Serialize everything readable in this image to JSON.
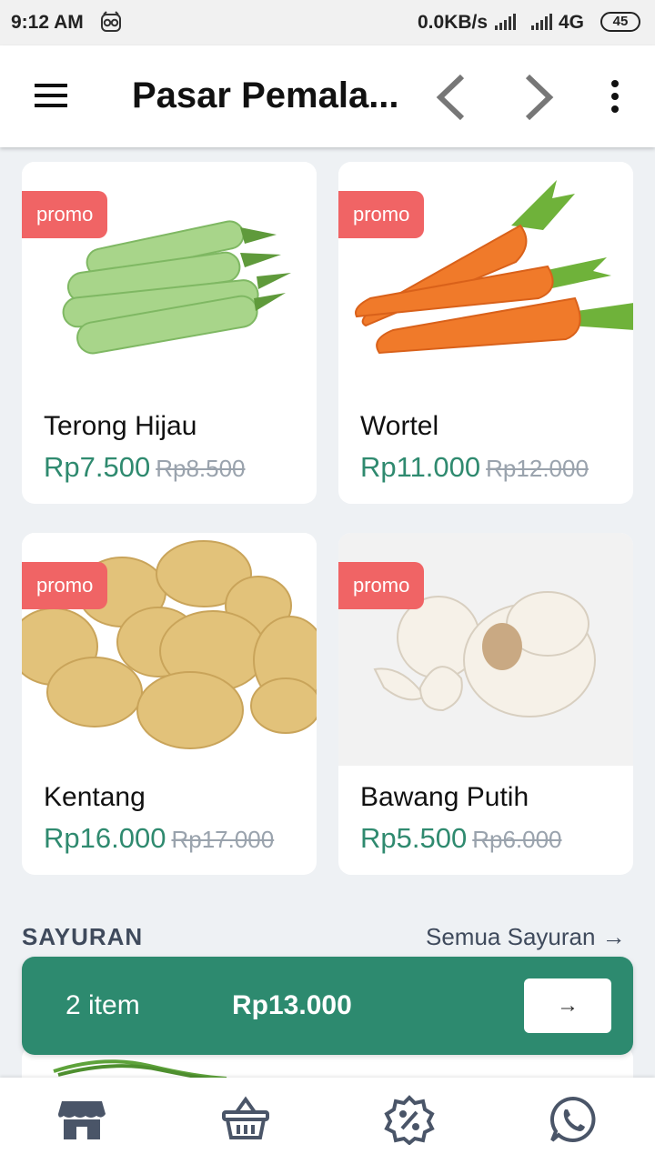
{
  "status_bar": {
    "time": "9:12 AM",
    "network_speed": "0.0KB/s",
    "network_type": "4G",
    "battery": "45"
  },
  "app_bar": {
    "title": "Pasar Pemala..."
  },
  "products": [
    {
      "badge": "promo",
      "name": "Terong Hijau",
      "price": "Rp7.500",
      "old_price": "Rp8.500"
    },
    {
      "badge": "promo",
      "name": "Wortel",
      "price": "Rp11.000",
      "old_price": "Rp12.000"
    },
    {
      "badge": "promo",
      "name": "Kentang",
      "price": "Rp16.000",
      "old_price": "Rp17.000"
    },
    {
      "badge": "promo",
      "name": "Bawang Putih",
      "price": "Rp5.500",
      "old_price": "Rp6.000"
    }
  ],
  "section": {
    "title": "SAYURAN",
    "link": "Semua Sayuran →"
  },
  "cart": {
    "count": "2 item",
    "total": "Rp13.000",
    "go_label": "→"
  },
  "bottom_nav": [
    {
      "icon": "store-icon"
    },
    {
      "icon": "basket-icon"
    },
    {
      "icon": "promo-badge-icon"
    },
    {
      "icon": "whatsapp-icon"
    }
  ],
  "colors": {
    "accent": "#2d8a6f",
    "promo": "#f06465",
    "price": "#2f8a6f",
    "background": "#eef1f4"
  }
}
